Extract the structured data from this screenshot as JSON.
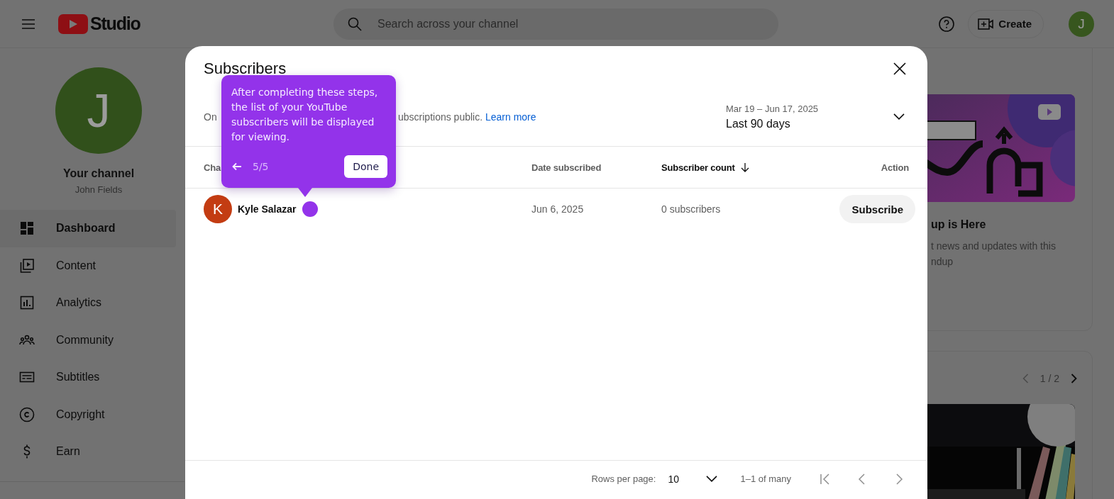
{
  "topbar": {
    "logo_text": "Studio",
    "search": {
      "placeholder": "Search across your channel"
    },
    "create_button": "Create",
    "avatar_letter": "J"
  },
  "sidebar": {
    "avatar_letter": "J",
    "title": "Your channel",
    "name": "John Fields",
    "items": [
      {
        "kind": "dashboard",
        "label": "Dashboard",
        "selected": true
      },
      {
        "kind": "content",
        "label": "Content",
        "selected": false
      },
      {
        "kind": "analytics",
        "label": "Analytics",
        "selected": false
      },
      {
        "kind": "community",
        "label": "Community",
        "selected": false
      },
      {
        "kind": "subtitles",
        "label": "Subtitles",
        "selected": false
      },
      {
        "kind": "copyright",
        "label": "Copyright",
        "selected": false
      },
      {
        "kind": "earn",
        "label": "Earn",
        "selected": false
      }
    ]
  },
  "background": {
    "news_card": {
      "title": "up is Here",
      "description_lines": [
        "t news and updates with this",
        "ndup"
      ]
    },
    "video_card": {
      "pager_text": "1 / 2"
    }
  },
  "dialog": {
    "title": "Subscribers",
    "description_parts": [
      "On",
      "ubscriptions public."
    ],
    "link": "Learn more",
    "date_range": "Mar 19 – Jun 17, 2025",
    "period": "Last 90 days",
    "columns": [
      {
        "label": "Cha",
        "sorted": false
      },
      {
        "label": "Date subscribed",
        "sorted": false
      },
      {
        "label": "Subscriber count",
        "sorted": true
      },
      {
        "label": "Action",
        "sorted": false
      }
    ],
    "rows": [
      {
        "avatar_letter": "K",
        "channel": "Kyle Salazar",
        "date": "Jun 6, 2025",
        "subscriber_count": "0 subscribers",
        "action": "Subscribe"
      }
    ],
    "footer": {
      "rows_per_page_label": "Rows per page:",
      "rows_per_page": "10",
      "range": "1–1 of many"
    }
  },
  "tour": {
    "text": "After completing these steps, the list of your YouTube subscribers will be displayed for viewing.",
    "step": "5/5",
    "done_button": "Done"
  }
}
